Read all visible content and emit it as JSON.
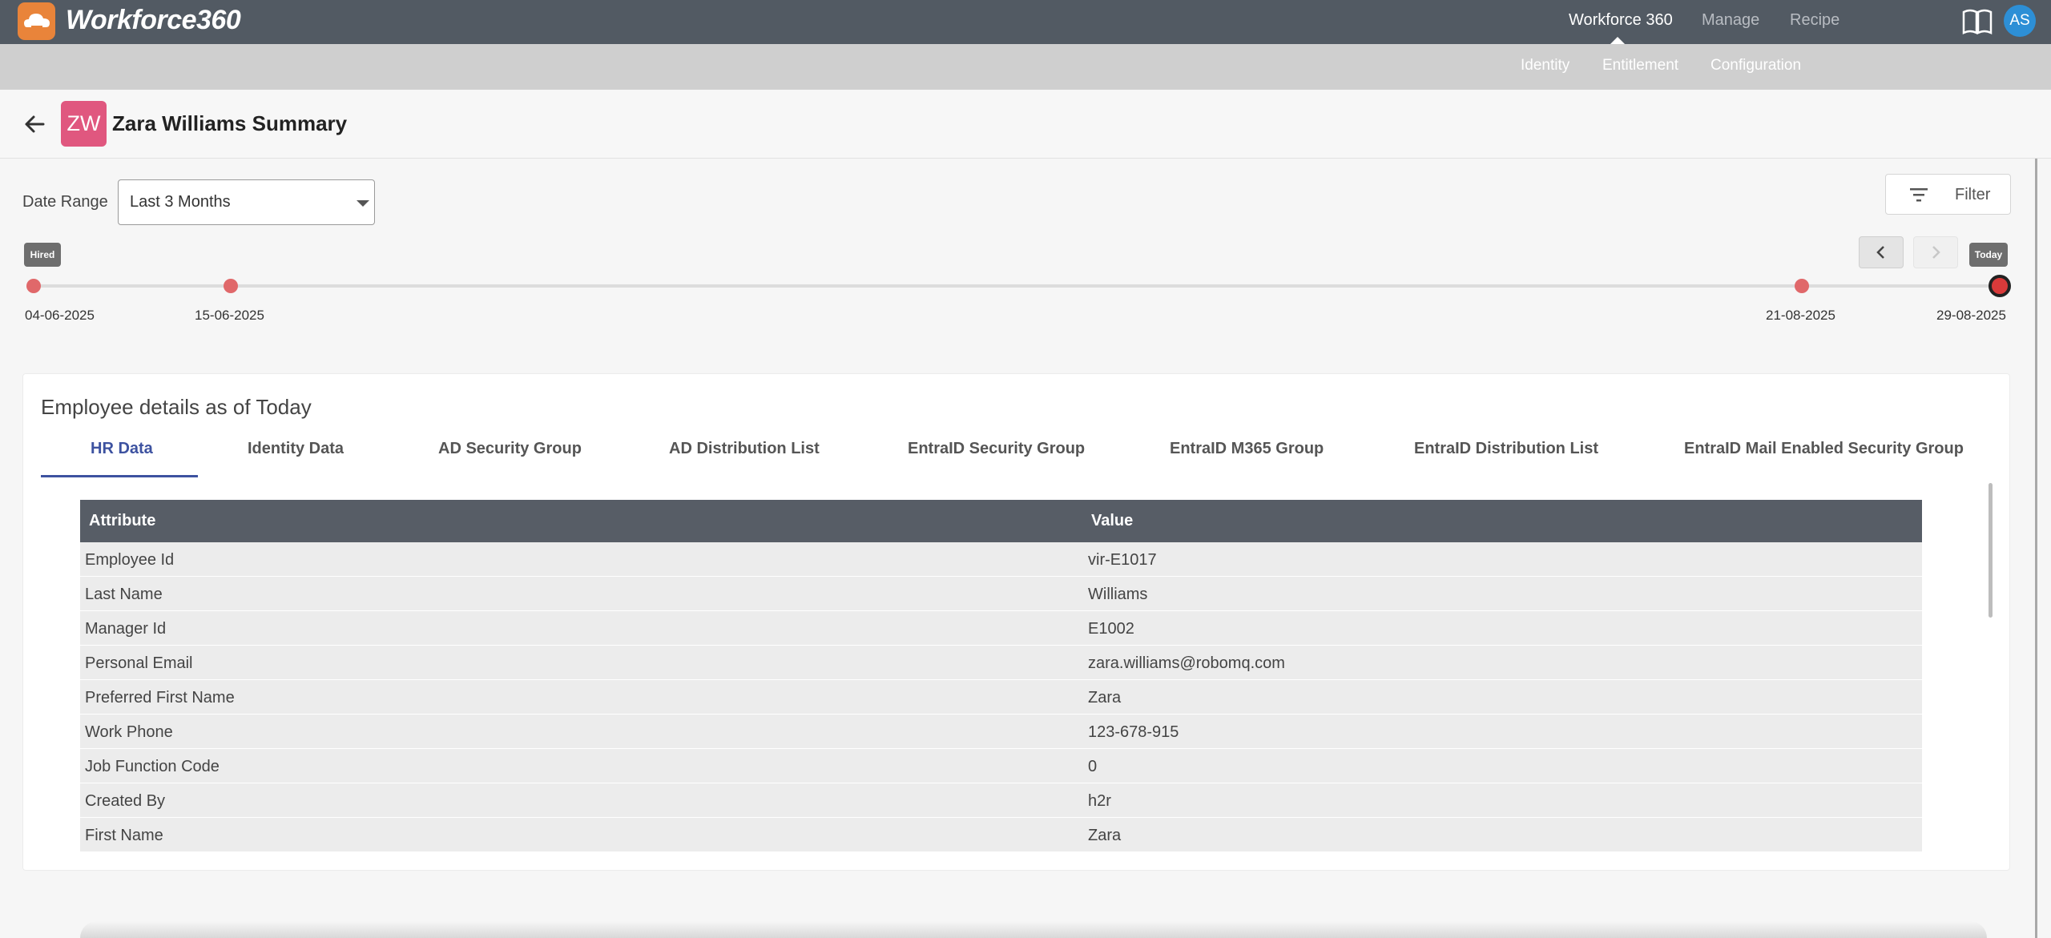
{
  "app": {
    "brand": "Workforce360",
    "user_initials": "AS"
  },
  "top_nav": [
    {
      "label": "Workforce 360",
      "active": true
    },
    {
      "label": "Manage",
      "active": false
    },
    {
      "label": "Recipe",
      "active": false
    }
  ],
  "sub_nav": [
    "Identity",
    "Entitlement",
    "Configuration"
  ],
  "header": {
    "avatar_initials": "ZW",
    "title": "Zara Williams Summary",
    "avatar_color": "#e0577f"
  },
  "date_range": {
    "label": "Date Range",
    "value": "Last 3 Months"
  },
  "filter": {
    "label": "Filter"
  },
  "timeline": {
    "start_tag": "Hired",
    "end_tag": "Today",
    "dates": [
      "04-06-2025",
      "15-06-2025",
      "21-08-2025",
      "29-08-2025"
    ]
  },
  "details": {
    "title": "Employee details as of Today",
    "tabs": [
      "HR Data",
      "Identity Data",
      "AD Security Group",
      "AD Distribution List",
      "EntraID Security Group",
      "EntraID M365 Group",
      "EntraID Distribution List",
      "EntraID Mail Enabled Security Group"
    ],
    "active_tab": "HR Data",
    "columns": [
      "Attribute",
      "Value"
    ],
    "rows": [
      [
        "Employee Id",
        "vir-E1017"
      ],
      [
        "Last Name",
        "Williams"
      ],
      [
        "Manager Id",
        "E1002"
      ],
      [
        "Personal Email",
        "zara.williams@robomq.com"
      ],
      [
        "Preferred First Name",
        "Zara"
      ],
      [
        "Work Phone",
        "123-678-915"
      ],
      [
        "Job Function Code",
        "0"
      ],
      [
        "Created By",
        "h2r"
      ],
      [
        "First Name",
        "Zara"
      ]
    ]
  },
  "colors": {
    "topbar": "#525a63",
    "accent": "#3d52a0",
    "timeline_dot": "#e0686a",
    "logo": "#e9843a"
  }
}
